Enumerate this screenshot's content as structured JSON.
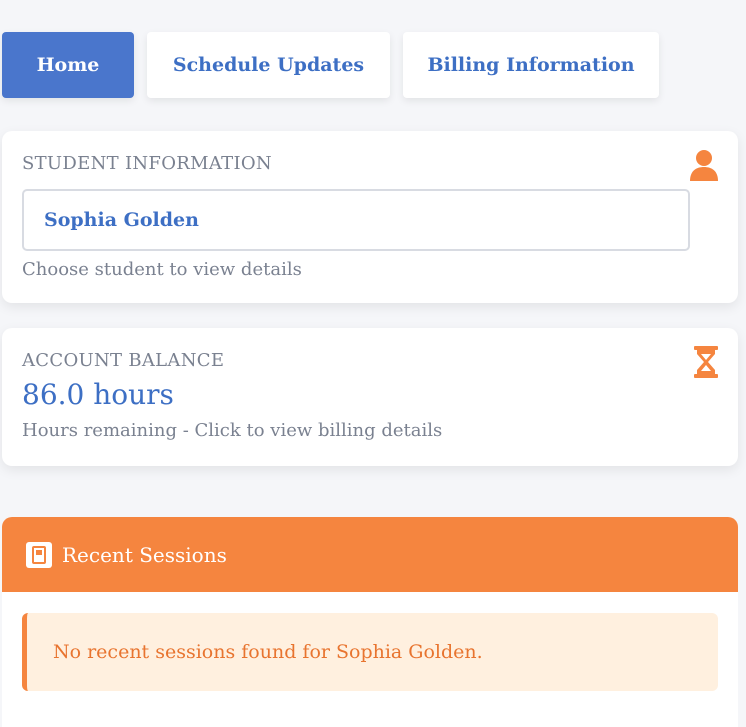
{
  "tabs": [
    {
      "label": "Home",
      "active": true
    },
    {
      "label": "Schedule Updates",
      "active": false
    },
    {
      "label": "Billing Information",
      "active": false
    }
  ],
  "student": {
    "label": "STUDENT INFORMATION",
    "icon": "user-icon",
    "selected": "Sophia Golden",
    "helper": "Choose student to view details"
  },
  "balance": {
    "label": "ACCOUNT BALANCE",
    "icon": "hourglass-icon",
    "value": "86.0 hours",
    "helper": "Hours remaining - Click to view billing details"
  },
  "sessions": {
    "title": "Recent Sessions",
    "icon": "notebook-icon",
    "empty_message": "No recent sessions found for Sophia Golden."
  },
  "colors": {
    "primary": "#4a76cc",
    "primary_text": "#3d6fc4",
    "accent": "#f5853f",
    "alert_bg": "#fff0df",
    "page_bg": "#f5f6f9"
  }
}
